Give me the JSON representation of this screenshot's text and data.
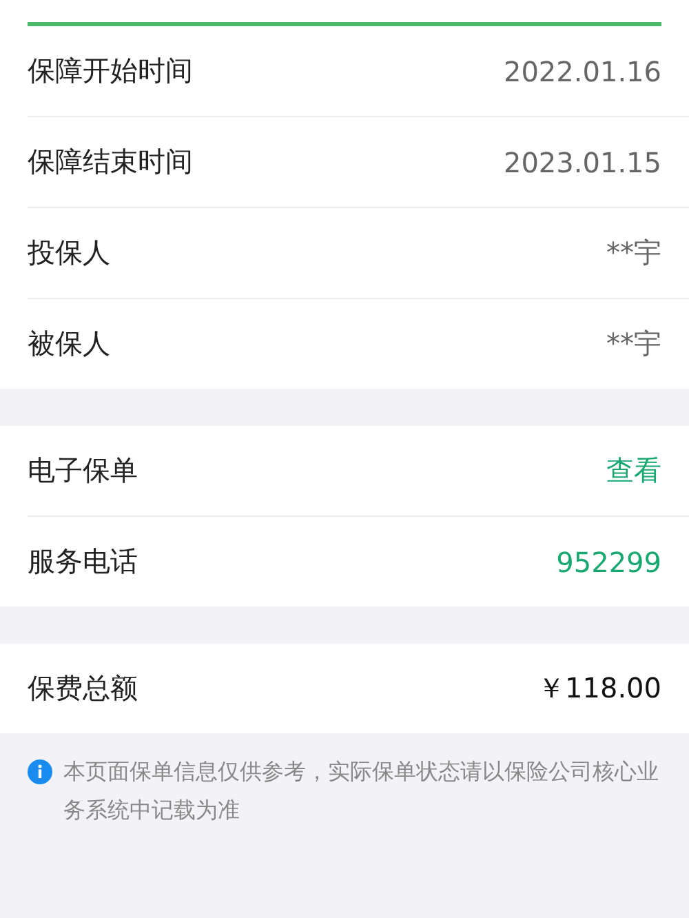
{
  "sections": [
    {
      "rows": [
        {
          "label": "保障开始时间",
          "value": "2022.01.16",
          "kind": "text"
        },
        {
          "label": "保障结束时间",
          "value": "2023.01.15",
          "kind": "text"
        },
        {
          "label": "投保人",
          "value": "**宇",
          "kind": "text"
        },
        {
          "label": "被保人",
          "value": "**宇",
          "kind": "text"
        }
      ]
    },
    {
      "rows": [
        {
          "label": "电子保单",
          "value": "查看",
          "kind": "link"
        },
        {
          "label": "服务电话",
          "value": "952299",
          "kind": "link"
        }
      ]
    },
    {
      "rows": [
        {
          "label": "保费总额",
          "value": "￥118.00",
          "kind": "total"
        }
      ]
    }
  ],
  "notice": "本页面保单信息仅供参考，实际保单状态请以保险公司核心业务系统中记载为准"
}
